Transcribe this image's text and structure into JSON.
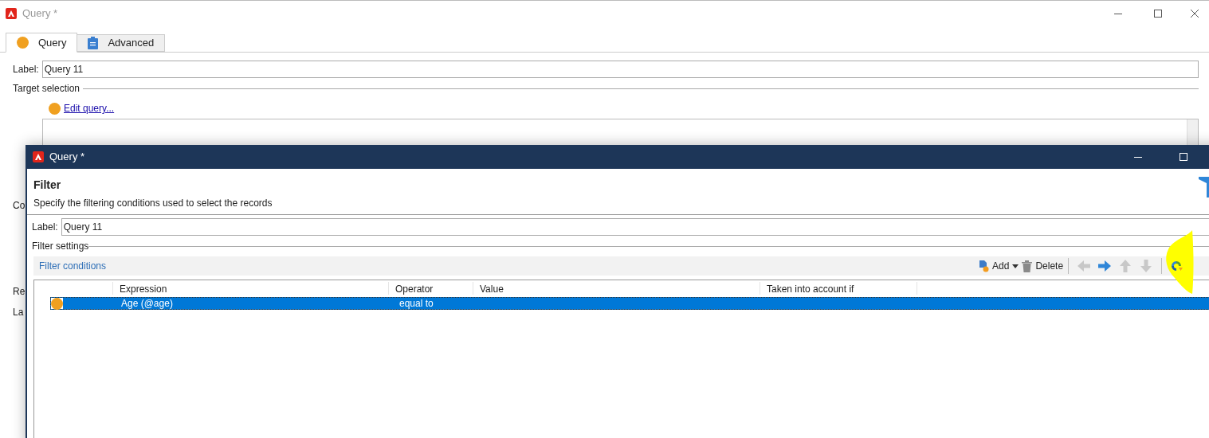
{
  "window": {
    "title": "Query *"
  },
  "tabs": [
    {
      "label": "Query",
      "kind": "status",
      "selected": true
    },
    {
      "label": "Advanced",
      "kind": "clipboard",
      "selected": false
    }
  ],
  "label_field": {
    "label": "Label:",
    "value": "Query 11"
  },
  "target_selection": {
    "heading": "Target selection",
    "link": "Edit query..."
  },
  "hidden_labels": [
    "Co",
    "Re",
    "La"
  ],
  "dialog": {
    "title": "Query *",
    "heading": "Filter",
    "subtitle": "Specify the filtering conditions used to select the records",
    "label_field": {
      "label": "Label:",
      "value": "Query 11"
    },
    "section": "Filter settings",
    "panel_title": "Filter conditions",
    "toolbar": [
      {
        "kind": "add",
        "label": "Add",
        "disabled": false
      },
      {
        "kind": "delete",
        "label": "Delete",
        "disabled": false
      },
      {
        "kind": "left",
        "disabled": true
      },
      {
        "kind": "right",
        "disabled": false
      },
      {
        "kind": "up",
        "disabled": true
      },
      {
        "kind": "down",
        "disabled": true
      },
      {
        "kind": "refresh",
        "disabled": false
      }
    ],
    "columns": [
      "Expression",
      "Operator",
      "Value",
      "Taken into account if"
    ],
    "rows": [
      {
        "expression": "Age (@age)",
        "operator": "equal to",
        "selected": true
      }
    ]
  }
}
